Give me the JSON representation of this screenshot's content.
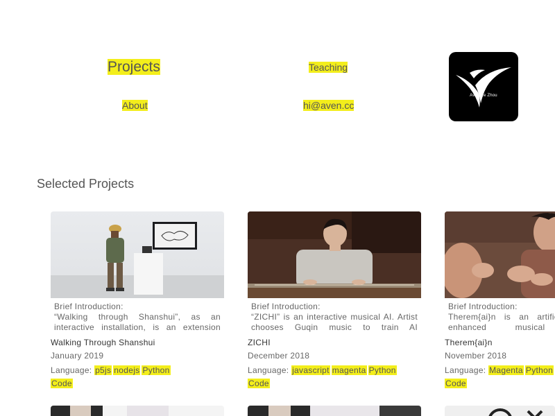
{
  "nav": {
    "projects": "Projects",
    "teaching": "Teaching",
    "about": "About",
    "email": "hi@aven.cc"
  },
  "logo": {
    "text": "Aven Le Zhou",
    "icon": "aven-logo-icon"
  },
  "section": {
    "title": "Selected Projects"
  },
  "colors": {
    "highlight": "#f3ee1b",
    "text": "#555555",
    "logo_bg": "#000000"
  },
  "projects": [
    {
      "intro_label": "Brief Introduction:",
      "intro_text": "“Walking through Shanshui”, as an interactive installation, is an extension",
      "title": "Walking Through Shanshui",
      "date": "January 2019",
      "language_label": "Language:",
      "tags": [
        "p5js",
        "nodejs",
        "Python"
      ],
      "code_label": "Code"
    },
    {
      "intro_label": "Brief Introduction:",
      "intro_text": "“ZICHI” is an interactive musical AI. Artist chooses Guqin music to train AI",
      "title": "ZICHI",
      "date": "December 2018",
      "language_label": "Language:",
      "tags": [
        "javascript",
        "magenta",
        "Python"
      ],
      "code_label": "Code"
    },
    {
      "intro_label": "Brief Introduction:",
      "intro_text": "Therem{ai}n is an artificial-intelligence enhanced musical instrument",
      "title": "Therem{ai}n",
      "date": "November 2018",
      "language_label": "Language:",
      "tags": [
        "Magenta",
        "Python"
      ],
      "code_label": "Code"
    }
  ]
}
